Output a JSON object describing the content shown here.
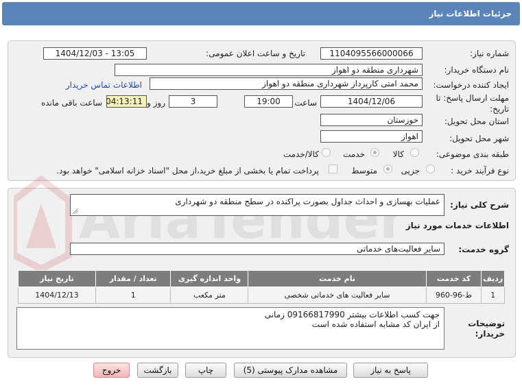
{
  "header": {
    "title": "جزئیات اطلاعات نیاز"
  },
  "need_number": {
    "label": "شماره نیاز:",
    "value": "1104095566000066"
  },
  "announce_datetime": {
    "label": "تاریخ و ساعت اعلان عمومی:",
    "value": "1404/12/03 - 13:05"
  },
  "buyer_org": {
    "label": "نام دستگاه خریدار:",
    "value": "شهرداری منطقه دو اهواز"
  },
  "creator": {
    "label": "ایجاد کننده درخواست:",
    "value": "محمد امتی کارپرداز شهرداری منطقه دو اهواز",
    "contact_link": "اطلاعات تماس خریدار"
  },
  "deadline": {
    "label_line1": "مهلت ارسال پاسخ: تا",
    "label_line2": "تاریخ:",
    "date": "1404/12/06",
    "time_label": "ساعت",
    "time": "19:00",
    "days": "3",
    "days_label": "روز و",
    "remaining": "04:13:11",
    "remaining_label": "ساعت باقی مانده"
  },
  "province": {
    "label": "استان محل تحویل:",
    "value": "خوزستان"
  },
  "city": {
    "label": "شهر محل تحویل:",
    "value": "اهواز"
  },
  "category": {
    "label": "طبقه بندی موضوعی:",
    "options": [
      "کالا",
      "خدمت",
      "کالا/خدمت"
    ],
    "selected": "خدمت"
  },
  "purchase_type": {
    "label": "نوع فرآیند خرید :",
    "options": [
      "جزیی",
      "متوسط"
    ],
    "selected": "متوسط",
    "payment_note": "پرداخت تمام یا بخشی از مبلغ خرید،از محل \"اسناد خزانه اسلامی\" خواهد بود."
  },
  "summary": {
    "label": "شرح کلی نیاز:",
    "value": "عملیات بهسازی و احداث جداول بصورت پراکنده در سطح منطقه دو شهرداری"
  },
  "services_title": "اطلاعات خدمات مورد نیاز",
  "service_group": {
    "label": "گروه خدمت:",
    "value": "سایر فعالیت‌های خدماتی"
  },
  "table": {
    "headers": [
      "ردیف",
      "کد خدمت",
      "نام خدمت",
      "واحد اندازه گیری",
      "تعداد / مقدار",
      "تاریخ نیاز"
    ],
    "rows": [
      [
        "1",
        "ط-96-960",
        "سایر فعالیت های خدماتی شخصی",
        "متر مکعب",
        "1",
        "1404/12/13"
      ]
    ]
  },
  "buyer_notes": {
    "label_line1": "توضیحات",
    "label_line2": "خریدار:",
    "text": "جهت کسب اطلاعات بیشتر   09166817990 زمانی\nاز ایران کد مشابه استفاده شده است"
  },
  "buttons": {
    "reply": "پاسخ به نیاز",
    "view_docs": "مشاهده مدارک پیوستی (5)",
    "print": "چاپ",
    "back": "بازگشت",
    "exit": "خروج"
  },
  "watermark_text": "AriaTender.net",
  "colors": {
    "header": "#5b84b9",
    "table_header": "#7d7d7d",
    "remaining": "#f5f1ba",
    "link": "#1c48c8",
    "exit_button": "#f3b6b6"
  }
}
